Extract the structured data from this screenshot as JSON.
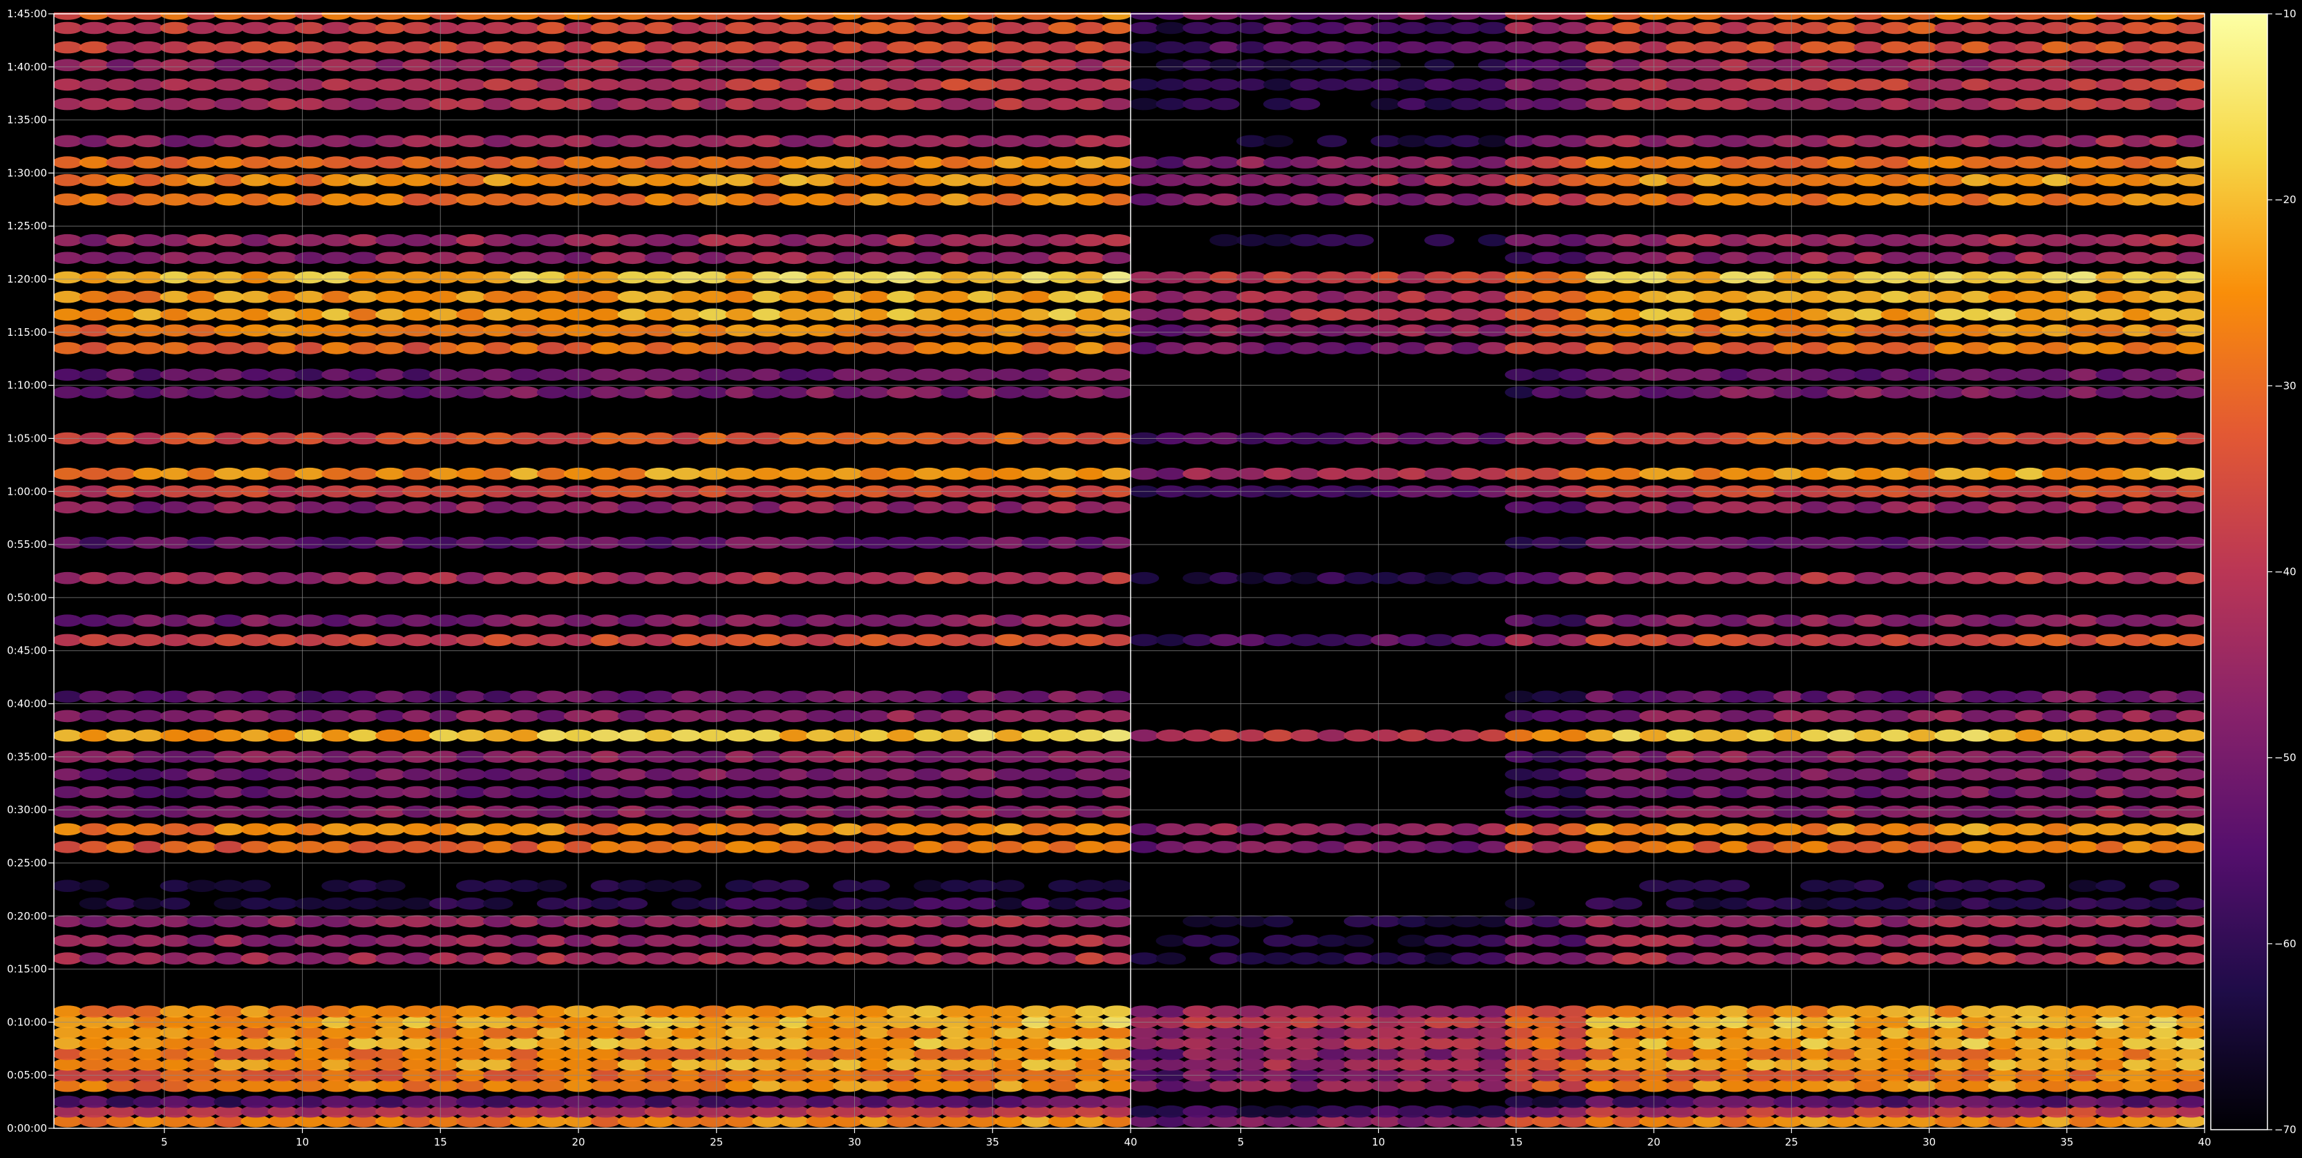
{
  "chart_data": [
    {
      "type": "heatmap",
      "panel": "left",
      "x_ticks": [
        "5",
        "10",
        "15",
        "20",
        "25",
        "30",
        "35",
        "40"
      ],
      "x_tick_values": [
        5,
        10,
        15,
        20,
        25,
        30,
        35,
        40
      ],
      "xlim": [
        1,
        40
      ],
      "y_ticks": [
        "0:00:00",
        "0:05:00",
        "0:10:00",
        "0:15:00",
        "0:20:00",
        "0:25:00",
        "0:30:00",
        "0:35:00",
        "0:40:00",
        "0:45:00",
        "0:50:00",
        "0:55:00",
        "1:00:00",
        "1:05:00",
        "1:10:00",
        "1:15:00",
        "1:20:00",
        "1:25:00",
        "1:30:00",
        "1:35:00",
        "1:40:00",
        "1:45:00"
      ],
      "y_tick_values_sec": [
        0,
        300,
        600,
        900,
        1200,
        1500,
        1800,
        2100,
        2400,
        2700,
        3000,
        3300,
        3600,
        3900,
        4200,
        4500,
        4800,
        5100,
        5400,
        5700,
        6000,
        6300
      ],
      "ylim_sec": [
        0,
        6300
      ],
      "grid": true,
      "row_profile": [
        {
          "t": 40,
          "v": -27
        },
        {
          "t": 95,
          "v": -40
        },
        {
          "t": 150,
          "v": -55
        },
        {
          "t": 240,
          "v": -26
        },
        {
          "t": 300,
          "v": -30
        },
        {
          "t": 360,
          "v": -24
        },
        {
          "t": 420,
          "v": -28
        },
        {
          "t": 480,
          "v": -22
        },
        {
          "t": 540,
          "v": -25
        },
        {
          "t": 600,
          "v": -21
        },
        {
          "t": 660,
          "v": -25
        },
        {
          "t": 960,
          "v": -42
        },
        {
          "t": 1060,
          "v": -44
        },
        {
          "t": 1170,
          "v": -45
        },
        {
          "t": 1270,
          "v": -62
        },
        {
          "t": 1370,
          "v": -65
        },
        {
          "t": 1590,
          "v": -30
        },
        {
          "t": 1690,
          "v": -26
        },
        {
          "t": 1790,
          "v": -47
        },
        {
          "t": 1900,
          "v": -50
        },
        {
          "t": 2000,
          "v": -50
        },
        {
          "t": 2100,
          "v": -47
        },
        {
          "t": 2220,
          "v": -20
        },
        {
          "t": 2330,
          "v": -48
        },
        {
          "t": 2440,
          "v": -52
        },
        {
          "t": 2760,
          "v": -36
        },
        {
          "t": 2870,
          "v": -48
        },
        {
          "t": 3110,
          "v": -42
        },
        {
          "t": 3310,
          "v": -52
        },
        {
          "t": 3510,
          "v": -46
        },
        {
          "t": 3600,
          "v": -36
        },
        {
          "t": 3700,
          "v": -24
        },
        {
          "t": 3900,
          "v": -34
        },
        {
          "t": 4160,
          "v": -50
        },
        {
          "t": 4260,
          "v": -52
        },
        {
          "t": 4410,
          "v": -30
        },
        {
          "t": 4510,
          "v": -27
        },
        {
          "t": 4600,
          "v": -22
        },
        {
          "t": 4700,
          "v": -23
        },
        {
          "t": 4810,
          "v": -19
        },
        {
          "t": 4920,
          "v": -46
        },
        {
          "t": 5020,
          "v": -44
        },
        {
          "t": 5250,
          "v": -28
        },
        {
          "t": 5360,
          "v": -25
        },
        {
          "t": 5460,
          "v": -28
        },
        {
          "t": 5580,
          "v": -45
        },
        {
          "t": 5790,
          "v": -42
        },
        {
          "t": 5900,
          "v": -40
        },
        {
          "t": 6010,
          "v": -44
        },
        {
          "t": 6110,
          "v": -36
        },
        {
          "t": 6220,
          "v": -36
        },
        {
          "t": 6300,
          "v": -30
        }
      ]
    },
    {
      "type": "heatmap",
      "panel": "right",
      "x_ticks": [
        "5",
        "10",
        "15",
        "20",
        "25",
        "30",
        "35",
        "40"
      ],
      "x_tick_values": [
        5,
        10,
        15,
        20,
        25,
        30,
        35,
        40
      ],
      "xlim": [
        1,
        40
      ],
      "y_ticks": [],
      "ylim_sec": [
        0,
        6300
      ],
      "grid": true,
      "onset_col": 14,
      "early_level_offset": -18,
      "row_profile": "same_as_left"
    }
  ],
  "colorbar": {
    "colormap": "inferno",
    "range": [
      -70,
      -10
    ],
    "ticks": [
      "−10",
      "−20",
      "−30",
      "−40",
      "−50",
      "−60",
      "−70"
    ],
    "tick_values": [
      -10,
      -20,
      -30,
      -40,
      -50,
      -60,
      -70
    ]
  },
  "colors": {
    "background": "#000000",
    "grid": "#8a8a8a",
    "text": "#ffffff",
    "axis": "#ffffff"
  }
}
